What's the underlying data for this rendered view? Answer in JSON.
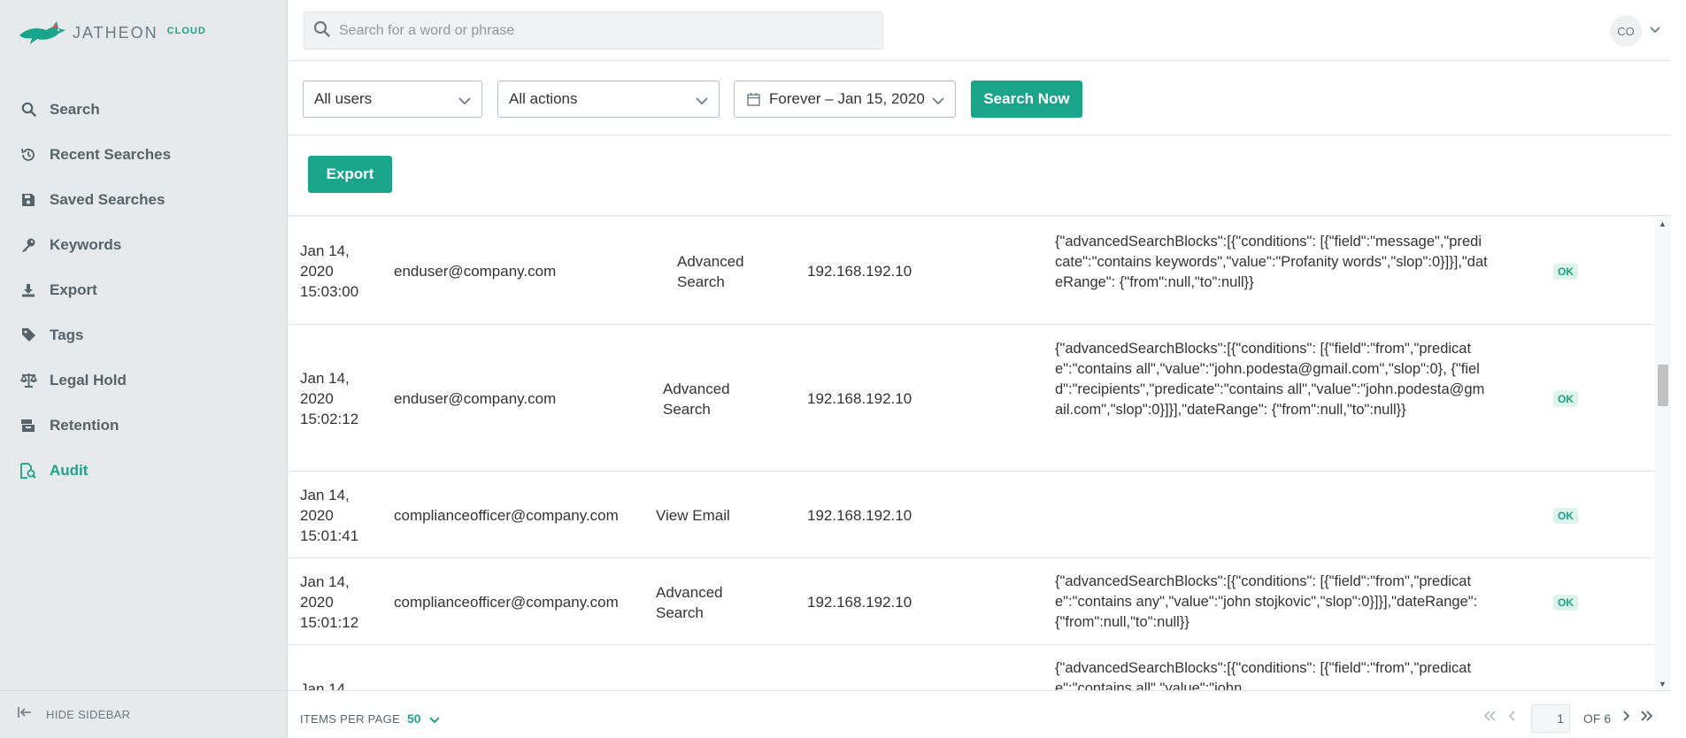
{
  "brand": {
    "name": "JATHEON",
    "suffix": "CLOUD"
  },
  "sidebar": {
    "items": [
      {
        "label": "Search",
        "icon": "search-icon",
        "active": false
      },
      {
        "label": "Recent Searches",
        "icon": "history-icon",
        "active": false
      },
      {
        "label": "Saved Searches",
        "icon": "save-icon",
        "active": false
      },
      {
        "label": "Keywords",
        "icon": "key-icon",
        "active": false
      },
      {
        "label": "Export",
        "icon": "download-icon",
        "active": false
      },
      {
        "label": "Tags",
        "icon": "tag-icon",
        "active": false
      },
      {
        "label": "Legal Hold",
        "icon": "scales-icon",
        "active": false
      },
      {
        "label": "Retention",
        "icon": "archive-icon",
        "active": false
      },
      {
        "label": "Audit",
        "icon": "audit-icon",
        "active": true
      }
    ],
    "hide_label": "HIDE SIDEBAR"
  },
  "header": {
    "search_placeholder": "Search for a word or phrase",
    "avatar_initials": "CO"
  },
  "filters": {
    "users": "All users",
    "actions": "All actions",
    "date_range": "Forever – Jan 15, 2020",
    "search_button": "Search Now"
  },
  "toolbar": {
    "export_label": "Export"
  },
  "rows": [
    {
      "date": "Jan 14, 2020 15:03:00",
      "user": "enduser@company.com",
      "action": "Advanced Search",
      "ip": "192.168.192.10",
      "params": "{\"advancedSearchBlocks\":[{\"conditions\": [{\"field\":\"message\",\"predicate\":\"contains keywords\",\"value\":\"Profanity words\",\"slop\":0}]}],\"dateRange\": {\"from\":null,\"to\":null}}",
      "status": "OK"
    },
    {
      "date": "Jan 14, 2020 15:02:12",
      "user": "enduser@company.com",
      "action": "Advanced Search",
      "ip": "192.168.192.10",
      "params": "{\"advancedSearchBlocks\":[{\"conditions\": [{\"field\":\"from\",\"predicate\":\"contains all\",\"value\":\"john.podesta@gmail.com\",\"slop\":0}, {\"field\":\"recipients\",\"predicate\":\"contains all\",\"value\":\"john.podesta@gmail.com\",\"slop\":0}]}],\"dateRange\": {\"from\":null,\"to\":null}}",
      "status": "OK"
    },
    {
      "date": "Jan 14, 2020 15:01:41",
      "user": "complianceofficer@company.com",
      "action": "View Email",
      "ip": "192.168.192.10",
      "params": "",
      "status": "OK"
    },
    {
      "date": "Jan 14, 2020 15:01:12",
      "user": "complianceofficer@company.com",
      "action": "Advanced Search",
      "ip": "192.168.192.10",
      "params": "{\"advancedSearchBlocks\":[{\"conditions\": [{\"field\":\"from\",\"predicate\":\"contains any\",\"value\":\"john stojkovic\",\"slop\":0}]}],\"dateRange\":{\"from\":null,\"to\":null}}",
      "status": "OK"
    },
    {
      "date": "Jan 14",
      "user": "",
      "action": "",
      "ip": "",
      "params": "{\"advancedSearchBlocks\":[{\"conditions\": [{\"field\":\"from\",\"predicate\":\"contains all\",\"value\":\"john",
      "status": ""
    }
  ],
  "footer": {
    "items_per_page_label": "ITEMS PER PAGE",
    "items_per_page": "50",
    "page": "1",
    "of_label": "OF 6"
  },
  "colors": {
    "accent": "#1aa489",
    "sidebar_bg": "#e6eaec"
  }
}
